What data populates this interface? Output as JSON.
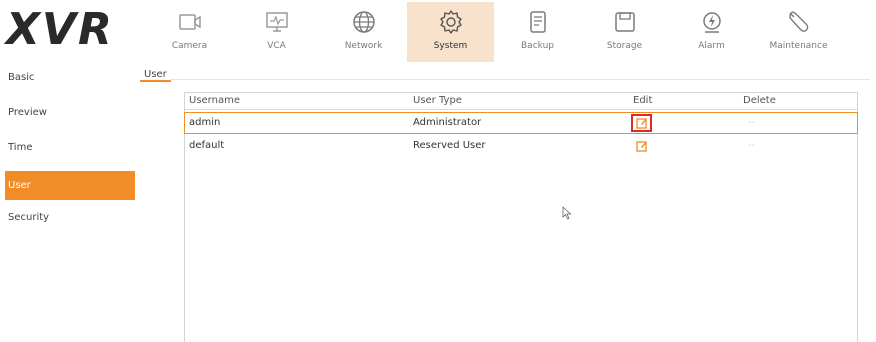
{
  "brand": {
    "logo": "XVR",
    "accent": "#f18c27",
    "highlight": "#f8e2cc"
  },
  "nav": [
    {
      "label": "Camera",
      "icon": "camera-icon"
    },
    {
      "label": "VCA",
      "icon": "vca-monitor-icon"
    },
    {
      "label": "Network",
      "icon": "globe-icon"
    },
    {
      "label": "System",
      "icon": "gear-icon",
      "active": true
    },
    {
      "label": "Backup",
      "icon": "backup-icon"
    },
    {
      "label": "Storage",
      "icon": "storage-icon"
    },
    {
      "label": "Alarm",
      "icon": "alarm-icon"
    },
    {
      "label": "Maintenance",
      "icon": "wrench-icon"
    }
  ],
  "sidebar": {
    "items": [
      {
        "label": "Basic"
      },
      {
        "label": "Preview"
      },
      {
        "label": "Time"
      },
      {
        "label": "User",
        "active": true
      },
      {
        "label": "Security"
      }
    ]
  },
  "tabs": [
    {
      "label": "User",
      "active": true
    }
  ],
  "table": {
    "headers": {
      "username": "Username",
      "user_type": "User Type",
      "edit": "Edit",
      "delete": "Delete"
    },
    "rows": [
      {
        "username": "admin",
        "user_type": "Administrator",
        "edit": "edit-icon",
        "delete": "--",
        "selected": true
      },
      {
        "username": "default",
        "user_type": "Reserved User",
        "edit": "edit-icon",
        "delete": "--"
      }
    ]
  }
}
